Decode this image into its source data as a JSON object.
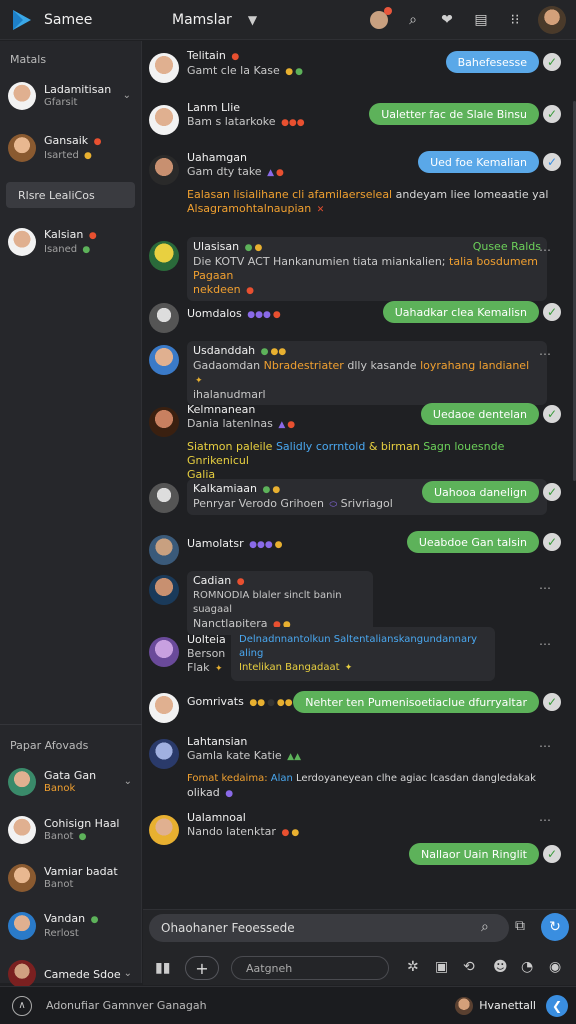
{
  "header": {
    "app_name": "Samee",
    "section_title": "Mamslar",
    "icons": [
      "notification-icon",
      "search-icon",
      "heart-icon",
      "window-icon",
      "grid-icon",
      "avatar"
    ]
  },
  "sidebar": {
    "heading": "Matals",
    "items": [
      {
        "name": "Ladamitisan",
        "sub": "Gfarsit"
      },
      {
        "name": "Gansaik",
        "sub": "Isarted"
      }
    ],
    "search_label": "Rlsre LealiCos",
    "items2": [
      {
        "name": "Kalsian",
        "sub": "Isaned"
      }
    ],
    "bottom_heading": "Papar Afovads",
    "bottom_items": [
      {
        "name": "Gata Gan",
        "sub": "Banok"
      },
      {
        "name": "Cohisign Haal",
        "sub": "Banot"
      },
      {
        "name": "Vamiar badat",
        "sub": "Banot"
      },
      {
        "name": "Vandan",
        "sub": "Rerlost"
      },
      {
        "name": "Camede Sdoe",
        "sub": ""
      }
    ]
  },
  "messages": [
    {
      "name": "Telitain",
      "text": "Gamt cle la Kase",
      "pill": "Bahefesesse"
    },
    {
      "name": "Lanm Llie",
      "text": "Bam s latarkoke",
      "pill": "Ualetter fac de Slale Binsu"
    },
    {
      "name": "Uahamgan",
      "text": "Gam dty take",
      "pill": "Ued foe Kemalian",
      "extra1": "Ealasan lisialihane cli afamilaerseleal",
      "extra1b": "andeyam liee lomeaatie yal",
      "extra2": "Alsagramohtalnaupian"
    },
    {
      "name": "Ulasisan",
      "text": "Die KOTV ACT Hankanumien tiata miankalien;",
      "text2": "nekdeen",
      "orange": "talia bosdumem Pagaan",
      "tag": "Qusee Ralds"
    },
    {
      "name": "Uomdalos",
      "text": "",
      "pill": "Uahadkar clea Kemalisn"
    },
    {
      "name": "Usdanddah",
      "text": "Gadaomdan",
      "orange": "Nbradestriater",
      "text3": "dlly kasande",
      "orange2": "loyrahang landianel",
      "text2": "ihalanudmarl"
    },
    {
      "name": "Kelmnanean",
      "text": "Dania latenlnas",
      "pill": "Uedaoe dentelan",
      "extra1": "Siatmon paleile",
      "extra1b": "Salidly corrntold",
      "extra1c": "& birman",
      "extra1d": "Sagn louesnde",
      "extra1e": "Gnrikenicul",
      "extra2": "Galia"
    },
    {
      "name": "Kalkamiaan",
      "text": "Penryar Verodo Grihoen",
      "text2": "Srivriagol",
      "pill": "Uahooa danelign"
    },
    {
      "name": "Uamolatsr",
      "text": "",
      "pill": "Ueabdoe Gan talsin"
    },
    {
      "name": "Cadian",
      "text": "ROMNODIA blaler sinclt banin suagaal",
      "text2": "Nanctlapitera"
    },
    {
      "name": "Uolteia",
      "text": "Berson",
      "text2": "Flak",
      "blue": "Delnadnnantolkun Saltentalianskangundannary aling",
      "orange": "Intelikan Bangadaat"
    },
    {
      "name": "Gomrivats",
      "text": "",
      "pill": "Nehter ten Pumenisoetiaclue dfurryaltar"
    },
    {
      "name": "Lahtansian",
      "text": "Gamla kate Katie",
      "extra1": "Fomat kedaima:",
      "extra1b": "Alan",
      "extra1c": "Lerdoyaneyean clhe agiac lcasdan dangledakak",
      "extra2": "olikad"
    },
    {
      "name": "Ualamnoal",
      "text": "Nando latenktar",
      "pill": ""
    },
    {
      "name": "",
      "text": "",
      "pill": "Nallaor Uain Ringlit"
    }
  ],
  "composer": {
    "placeholder": "Ohaohaner Feoessede",
    "tool_search": "Aatgneh"
  },
  "footer": {
    "text": "Adonufiar Gamnver Ganagah",
    "user": "Hvanettall"
  }
}
